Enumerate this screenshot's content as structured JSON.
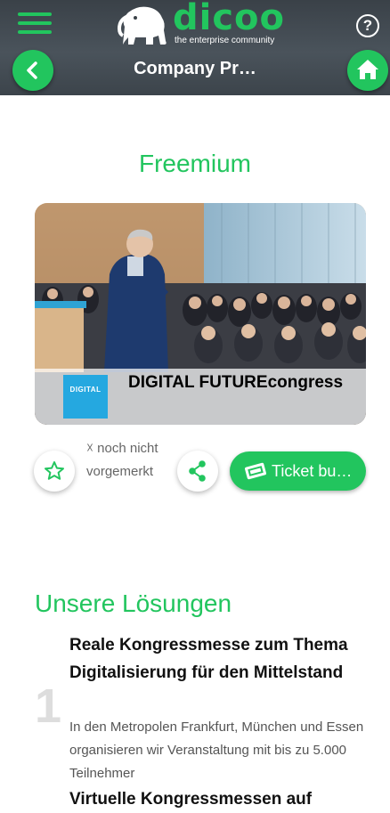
{
  "header": {
    "logo_text": "dicoo",
    "logo_tagline": "the enterprise community",
    "title": "Company Pr…",
    "help_label": "?"
  },
  "main": {
    "tier": "Freemium",
    "event": {
      "name": "DIGITAL FUTUREcongress",
      "logo_text": "DIGITAL"
    },
    "actions": {
      "bookmark_status": "☓ noch nicht vorgemerkt",
      "ticket_label": "Ticket bu…"
    },
    "solutions": {
      "heading": "Unsere Lösungen",
      "items": [
        {
          "number": "1",
          "title": "Reale Kongressmesse zum Thema Digitalisierung für den Mittelstand",
          "description": "In den Metropolen Frankfurt, München und Essen organisieren wir Veranstaltung mit bis zu 5.000 Teilnehmer"
        },
        {
          "title": "Virtuelle Kongressmessen auf"
        }
      ]
    }
  },
  "colors": {
    "accent": "#22c55e",
    "header_bg": "#424a51",
    "event_logo_bg": "#25a8e0"
  },
  "icons": [
    "menu-icon",
    "elephant-icon",
    "help-icon",
    "back-arrow-icon",
    "home-icon",
    "star-icon",
    "share-icon",
    "ticket-icon"
  ]
}
